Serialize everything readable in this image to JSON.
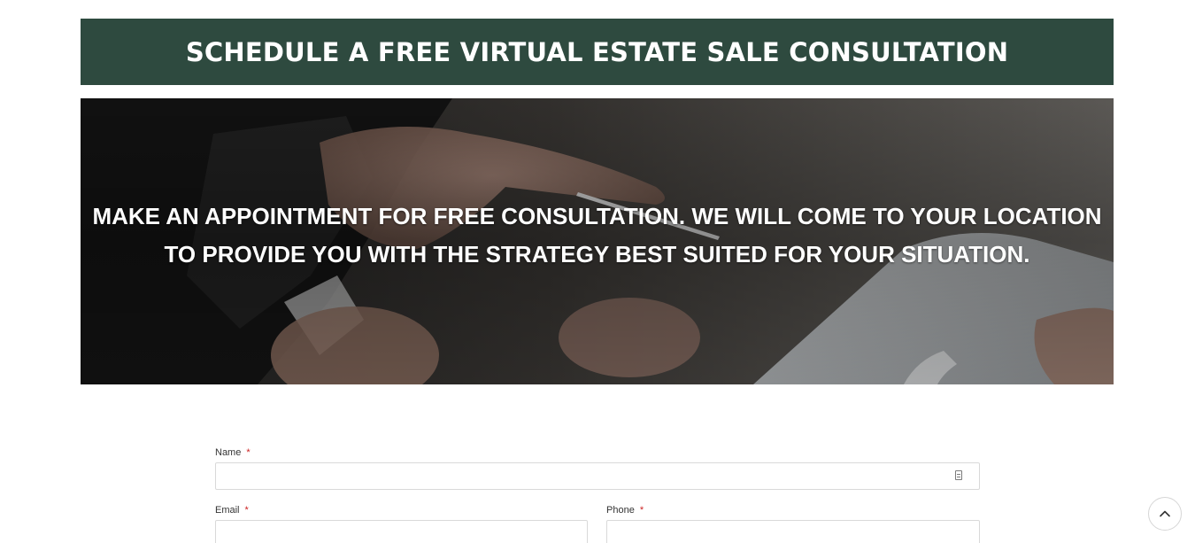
{
  "banner": {
    "title": "SCHEDULE A FREE VIRTUAL ESTATE SALE CONSULTATION"
  },
  "hero": {
    "line1": "MAKE AN APPOINTMENT FOR FREE CONSULTATION. WE WILL COME TO YOUR LOCATION",
    "line2": "TO PROVIDE YOU WITH THE STRATEGY BEST SUITED FOR YOUR SITUATION."
  },
  "form": {
    "name": {
      "label": "Name",
      "required_mark": "*",
      "value": "",
      "placeholder": ""
    },
    "email": {
      "label": "Email",
      "required_mark": "*",
      "value": "",
      "placeholder": ""
    },
    "phone": {
      "label": "Phone",
      "required_mark": "*",
      "value": "",
      "placeholder": ""
    }
  },
  "icons": {
    "autofill": "contact-card-icon",
    "scroll_top": "chevron-up-icon"
  },
  "colors": {
    "banner_bg": "#2e4a3f",
    "required": "#cc2222"
  }
}
